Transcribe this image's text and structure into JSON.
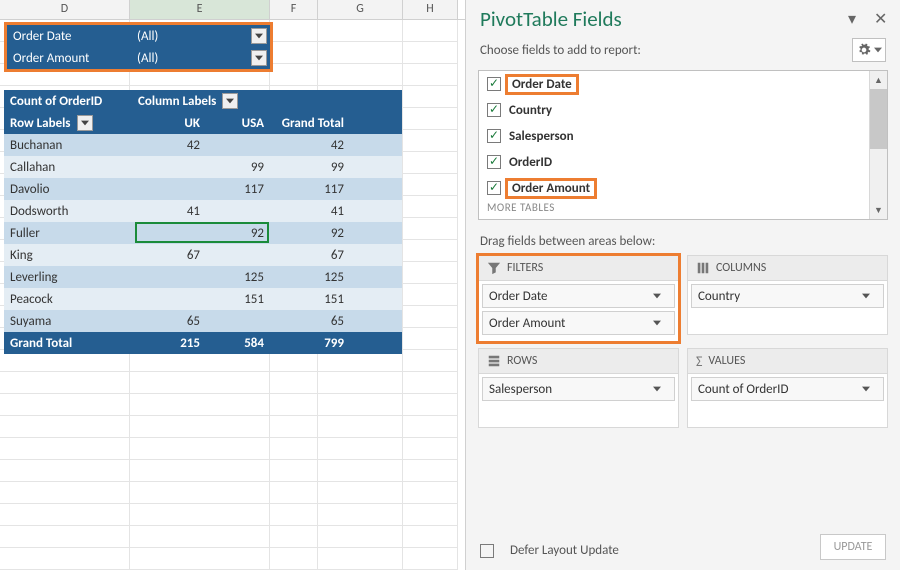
{
  "col_headers": [
    "D",
    "E",
    "F",
    "G",
    "H"
  ],
  "filters_block": {
    "rows": [
      {
        "label": "Order Date",
        "value": "(All)"
      },
      {
        "label": "Order Amount",
        "value": "(All)"
      }
    ]
  },
  "pivot": {
    "value_field_title": "Count of OrderID",
    "column_labels_title": "Column Labels",
    "row_labels_title": "Row Labels",
    "col_headers": [
      "UK",
      "USA",
      "Grand Total"
    ],
    "rows": [
      {
        "name": "Buchanan",
        "uk": "42",
        "usa": "",
        "total": "42"
      },
      {
        "name": "Callahan",
        "uk": "",
        "usa": "99",
        "total": "99"
      },
      {
        "name": "Davolio",
        "uk": "",
        "usa": "117",
        "total": "117"
      },
      {
        "name": "Dodsworth",
        "uk": "41",
        "usa": "",
        "total": "41"
      },
      {
        "name": "Fuller",
        "uk": "",
        "usa": "92",
        "total": "92"
      },
      {
        "name": "King",
        "uk": "67",
        "usa": "",
        "total": "67"
      },
      {
        "name": "Leverling",
        "uk": "",
        "usa": "125",
        "total": "125"
      },
      {
        "name": "Peacock",
        "uk": "",
        "usa": "151",
        "total": "151"
      },
      {
        "name": "Suyama",
        "uk": "65",
        "usa": "",
        "total": "65"
      }
    ],
    "grand_total": {
      "label": "Grand Total",
      "uk": "215",
      "usa": "584",
      "total": "799"
    }
  },
  "pane": {
    "title": "PivotTable Fields",
    "choose_label": "Choose fields to add to report:",
    "fields": [
      {
        "name": "Order Date",
        "checked": true,
        "highlight": true
      },
      {
        "name": "Country",
        "checked": true,
        "highlight": false
      },
      {
        "name": "Salesperson",
        "checked": true,
        "highlight": false
      },
      {
        "name": "OrderID",
        "checked": true,
        "highlight": false
      },
      {
        "name": "Order Amount",
        "checked": true,
        "highlight": true
      }
    ],
    "more_tables": "MORE TABLES",
    "drag_label": "Drag fields between areas below:",
    "areas": {
      "filters": {
        "title": "FILTERS",
        "items": [
          "Order Date",
          "Order Amount"
        ],
        "highlight": true
      },
      "columns": {
        "title": "COLUMNS",
        "items": [
          "Country"
        ]
      },
      "rows": {
        "title": "ROWS",
        "items": [
          "Salesperson"
        ]
      },
      "values": {
        "title": "VALUES",
        "items": [
          "Count of OrderID"
        ]
      }
    },
    "defer_label": "Defer Layout Update",
    "update_label": "UPDATE"
  }
}
